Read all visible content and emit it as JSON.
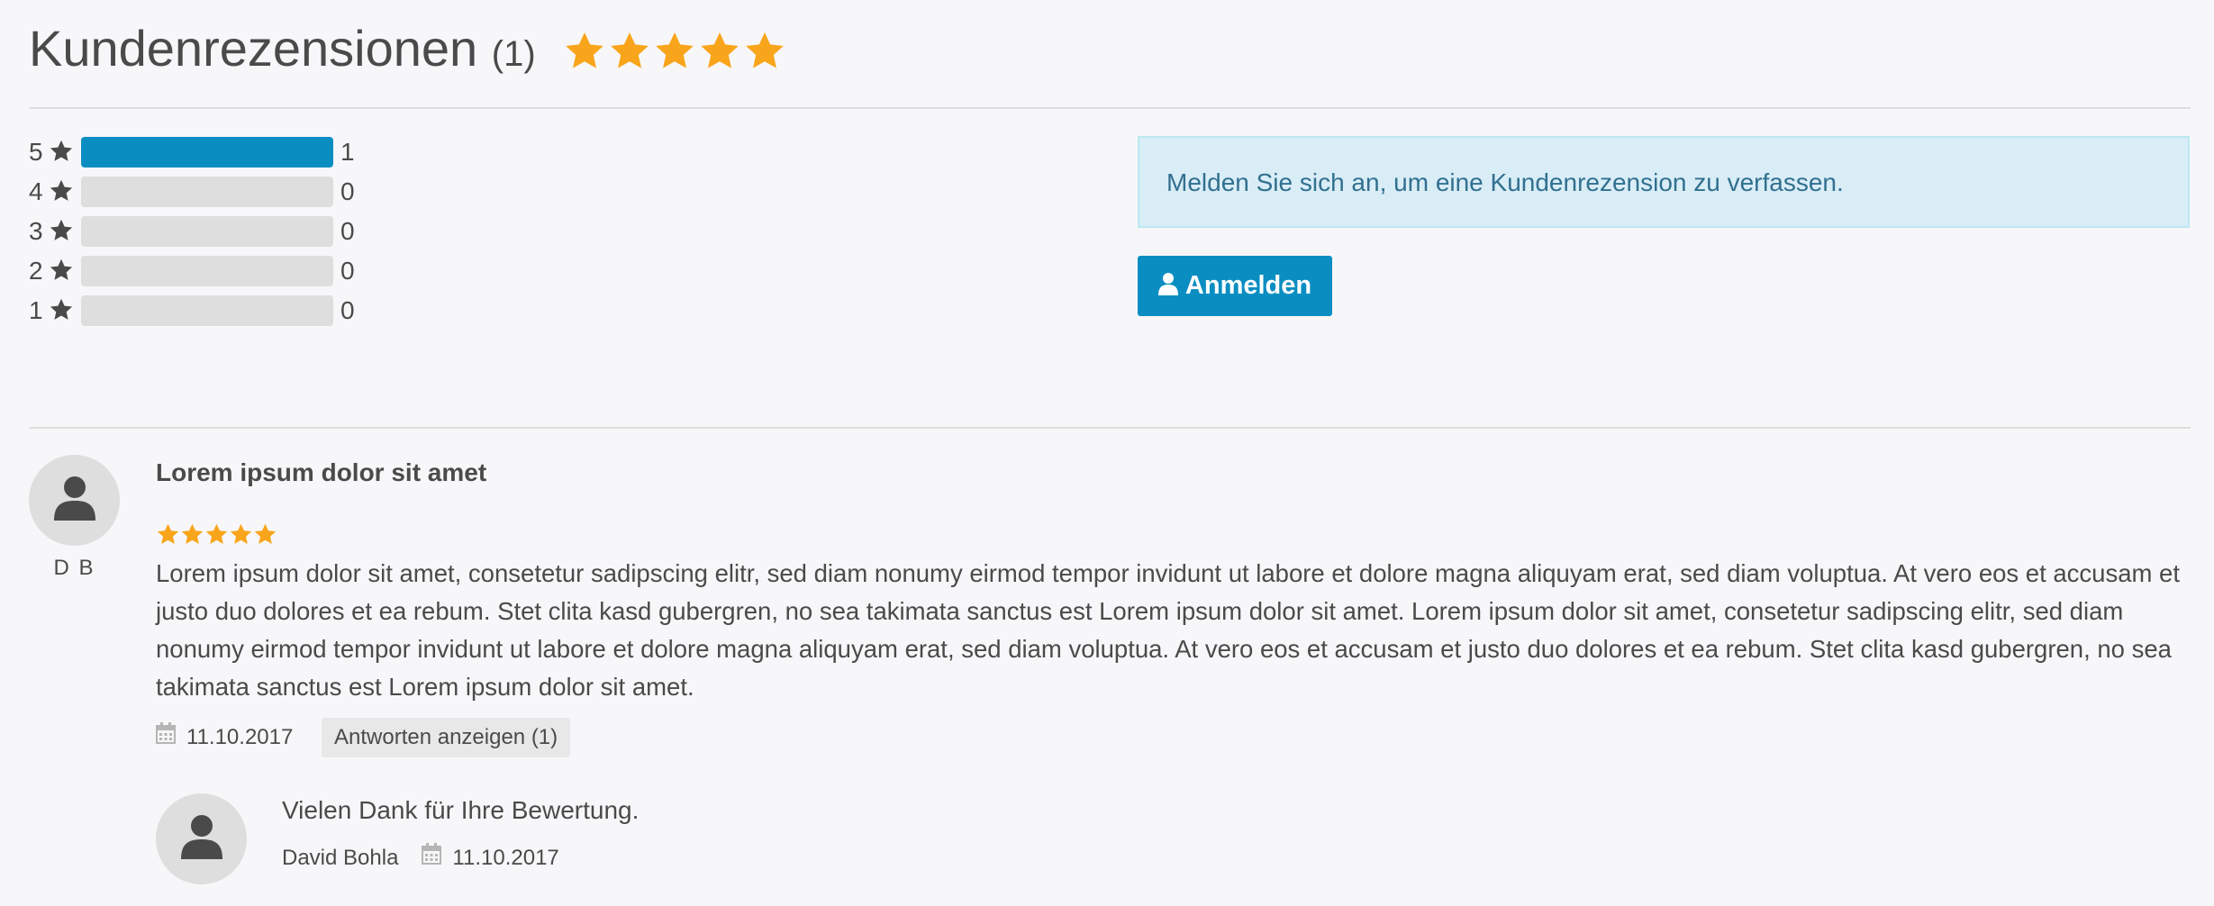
{
  "header": {
    "title": "Kundenrezensionen",
    "count_label": "(1)",
    "rating_stars": 5
  },
  "breakdown": [
    {
      "stars_label": "5",
      "count": "1",
      "fraction": 1.0
    },
    {
      "stars_label": "4",
      "count": "0",
      "fraction": 0.0
    },
    {
      "stars_label": "3",
      "count": "0",
      "fraction": 0.0
    },
    {
      "stars_label": "2",
      "count": "0",
      "fraction": 0.0
    },
    {
      "stars_label": "1",
      "count": "0",
      "fraction": 0.0
    }
  ],
  "login_notice": {
    "text": "Melden Sie sich an, um eine Kundenrezension zu verfassen.",
    "button_label": "Anmelden"
  },
  "review": {
    "author_initials": "D B",
    "title": "Lorem ipsum dolor sit amet",
    "rating_stars": 5,
    "body": "Lorem ipsum dolor sit amet, consetetur sadipscing elitr, sed diam nonumy eirmod tempor invidunt ut labore et dolore magna aliquyam erat, sed diam voluptua. At vero eos et accusam et justo duo dolores et ea rebum. Stet clita kasd gubergren, no sea takimata sanctus est Lorem ipsum dolor sit amet. Lorem ipsum dolor sit amet, consetetur sadipscing elitr, sed diam nonumy eirmod tempor invidunt ut labore et dolore magna aliquyam erat, sed diam voluptua. At vero eos et accusam et justo duo dolores et ea rebum. Stet clita kasd gubergren, no sea takimata sanctus est Lorem ipsum dolor sit amet.",
    "date": "11.10.2017",
    "replies_button": "Antworten anzeigen (1)"
  },
  "reply": {
    "text": "Vielen Dank für Ihre Bewertung.",
    "author": "David Bohla",
    "date": "11.10.2017"
  },
  "colors": {
    "star": "#f9a51b",
    "accent": "#0a8ec2",
    "notice_bg": "#d9edf7",
    "notice_text": "#31708f"
  }
}
